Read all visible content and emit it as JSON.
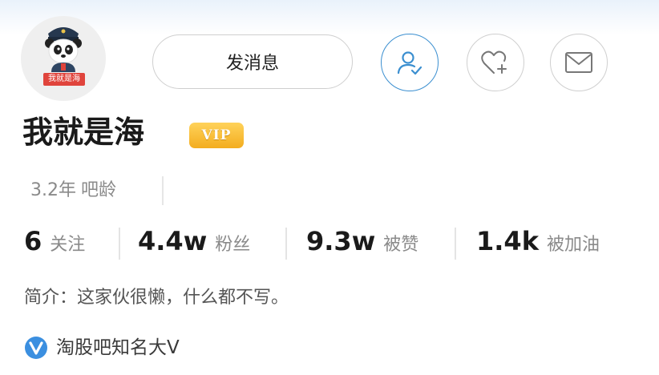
{
  "profile": {
    "avatar_tag": "我就是海",
    "username": "我就是海",
    "vip_label": "VIP",
    "age_value": "3.2年",
    "age_label": "吧龄",
    "intro": "简介：这家伙很懒，什么都不写。",
    "verified_text": "淘股吧知名大V"
  },
  "actions": {
    "message_label": "发消息",
    "follow_icon": "user-follow-icon",
    "like_icon": "heart-plus-icon",
    "mail_icon": "envelope-icon"
  },
  "stats": [
    {
      "value": "6",
      "label": "关注"
    },
    {
      "value": "4.4w",
      "label": "粉丝"
    },
    {
      "value": "9.3w",
      "label": "被赞"
    },
    {
      "value": "1.4k",
      "label": "被加油"
    }
  ],
  "colors": {
    "accent": "#3b8fd0",
    "vip_gold": "#f3ad1f",
    "verified_blue": "#3b8fe0",
    "tag_red": "#e0443c"
  }
}
